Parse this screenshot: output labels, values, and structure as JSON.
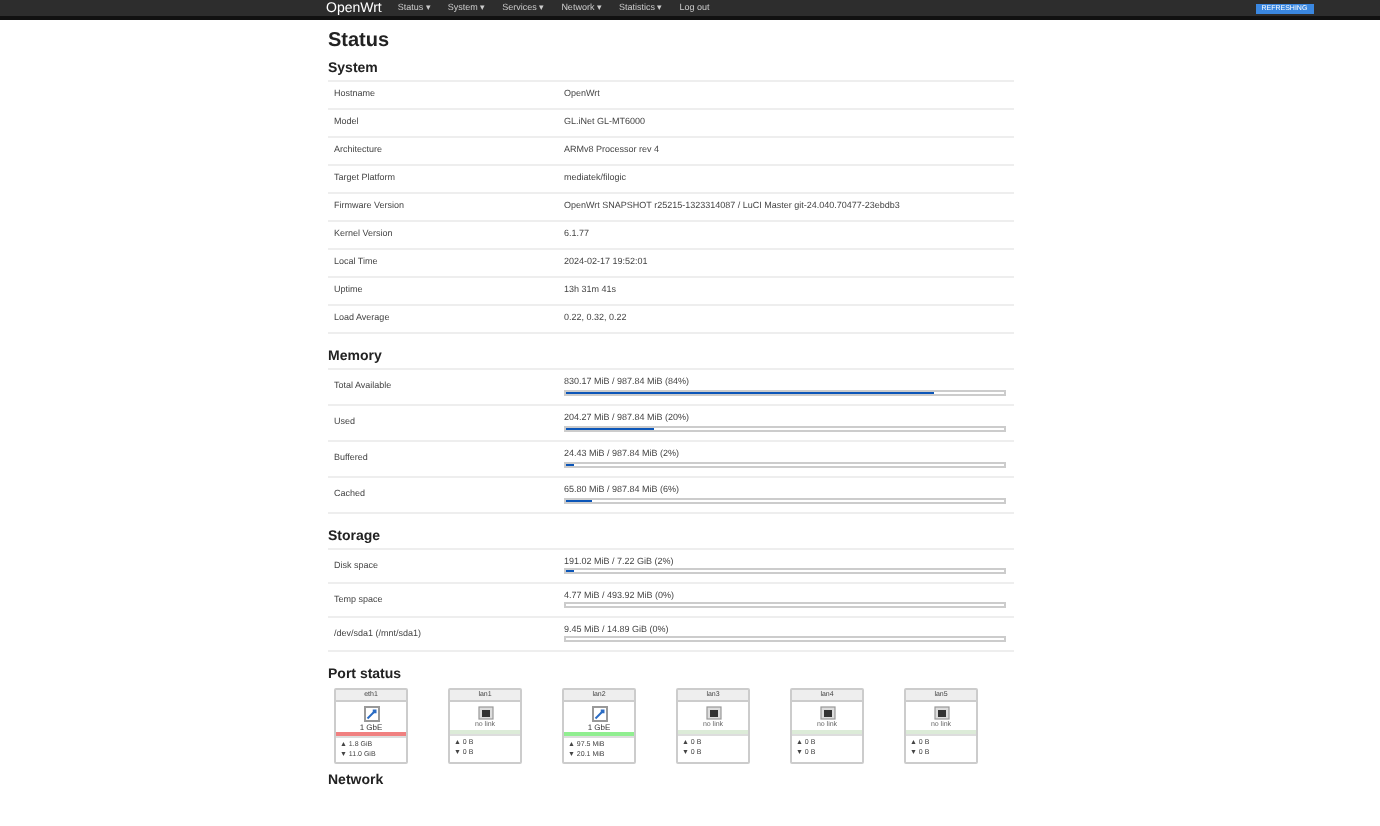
{
  "navbar": {
    "brand": "OpenWrt",
    "menu": [
      "Status ▾",
      "System ▾",
      "Services ▾",
      "Network ▾",
      "Statistics ▾",
      "Log out"
    ],
    "badge": "REFRESHING"
  },
  "title": "Status",
  "system": {
    "heading": "System",
    "rows": [
      {
        "label": "Hostname",
        "value": "OpenWrt"
      },
      {
        "label": "Model",
        "value": "GL.iNet GL-MT6000"
      },
      {
        "label": "Architecture",
        "value": "ARMv8 Processor rev 4"
      },
      {
        "label": "Target Platform",
        "value": "mediatek/filogic"
      },
      {
        "label": "Firmware Version",
        "value": "OpenWrt SNAPSHOT r25215-1323314087 / LuCI Master git-24.040.70477-23ebdb3"
      },
      {
        "label": "Kernel Version",
        "value": "6.1.77"
      },
      {
        "label": "Local Time",
        "value": "2024-02-17 19:52:01"
      },
      {
        "label": "Uptime",
        "value": "13h 31m 41s"
      },
      {
        "label": "Load Average",
        "value": "0.22, 0.32, 0.22"
      }
    ]
  },
  "memory": {
    "heading": "Memory",
    "rows": [
      {
        "label": "Total Available",
        "reading": "830.17 MiB / 987.84 MiB (84%)",
        "level": 0.84
      },
      {
        "label": "Used",
        "reading": "204.27 MiB / 987.84 MiB (20%)",
        "level": 0.2
      },
      {
        "label": "Buffered",
        "reading": "24.43 MiB / 987.84 MiB (2%)",
        "level": 0.02
      },
      {
        "label": "Cached",
        "reading": "65.80 MiB / 987.84 MiB (6%)",
        "level": 0.06
      }
    ]
  },
  "storage": {
    "heading": "Storage",
    "rows": [
      {
        "label": "Disk space",
        "reading": "191.02 MiB / 7.22 GiB (2%)",
        "level": 0.02
      },
      {
        "label": "Temp space",
        "reading": "4.77 MiB / 493.92 MiB (0%)",
        "level": 0
      },
      {
        "label": "/dev/sda1 (/mnt/sda1)",
        "reading": "9.45 MiB / 14.89 GiB (0%)",
        "level": 0
      }
    ]
  },
  "port_status": {
    "heading": "Port status",
    "ports": [
      {
        "name": "eth1",
        "link": true,
        "speed": "1 GbE",
        "color": "#f08080",
        "tx": "▲ 1.8 GiB",
        "rx": "▼ 11.0 GiB"
      },
      {
        "name": "lan1",
        "link": false,
        "speed": "no link",
        "color": "#dcebd8",
        "tx": "▲ 0 B",
        "rx": "▼ 0 B"
      },
      {
        "name": "lan2",
        "link": true,
        "speed": "1 GbE",
        "color": "#90ee90",
        "tx": "▲ 97.5 MiB",
        "rx": "▼ 20.1 MiB"
      },
      {
        "name": "lan3",
        "link": false,
        "speed": "no link",
        "color": "#dcebd8",
        "tx": "▲ 0 B",
        "rx": "▼ 0 B"
      },
      {
        "name": "lan4",
        "link": false,
        "speed": "no link",
        "color": "#dcebd8",
        "tx": "▲ 0 B",
        "rx": "▼ 0 B"
      },
      {
        "name": "lan5",
        "link": false,
        "speed": "no link",
        "color": "#dcebd8",
        "tx": "▲ 0 B",
        "rx": "▼ 0 B"
      }
    ]
  },
  "network": {
    "heading": "Network"
  }
}
